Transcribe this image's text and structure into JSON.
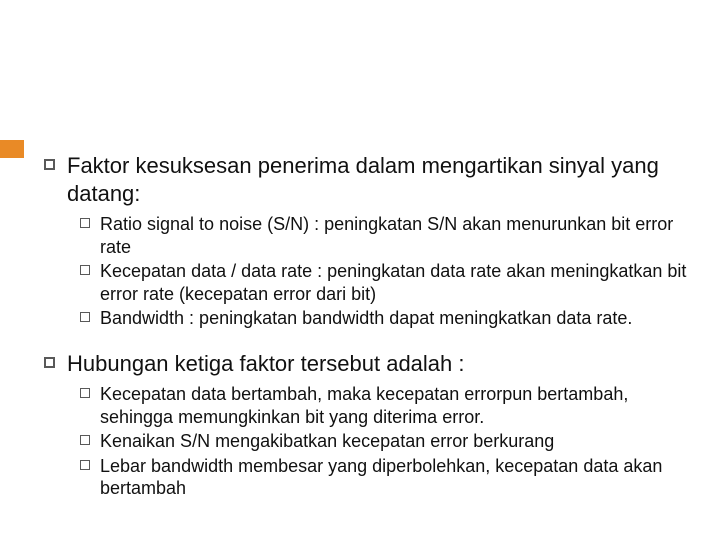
{
  "sections": [
    {
      "heading": "Faktor kesuksesan penerima dalam mengartikan sinyal yang datang:",
      "items": [
        "Ratio signal to noise (S/N) : peningkatan S/N akan menurunkan bit error rate",
        "Kecepatan data / data rate : peningkatan data rate akan meningkatkan bit error rate (kecepatan error dari bit)",
        "Bandwidth : peningkatan bandwidth dapat meningkatkan data rate."
      ]
    },
    {
      "heading": "Hubungan ketiga faktor tersebut adalah :",
      "items": [
        "Kecepatan data bertambah, maka kecepatan errorpun bertambah, sehingga memungkinkan bit yang diterima error.",
        "Kenaikan S/N mengakibatkan kecepatan error berkurang",
        "Lebar bandwidth membesar yang diperbolehkan, kecepatan data akan bertambah"
      ]
    }
  ]
}
